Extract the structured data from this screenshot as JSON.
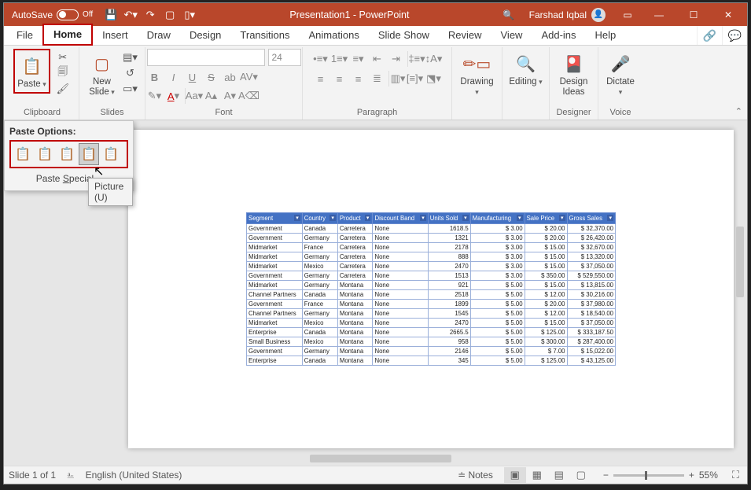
{
  "title_bar": {
    "autosave_label": "AutoSave",
    "autosave_state": "Off",
    "doc_title": "Presentation1 - PowerPoint",
    "user_name": "Farshad Iqbal"
  },
  "tabs": {
    "file": "File",
    "home": "Home",
    "insert": "Insert",
    "draw": "Draw",
    "design": "Design",
    "transitions": "Transitions",
    "animations": "Animations",
    "slideshow": "Slide Show",
    "review": "Review",
    "view": "View",
    "addins": "Add-ins",
    "help": "Help"
  },
  "ribbon": {
    "clipboard": {
      "paste": "Paste",
      "title": "Clipboard"
    },
    "slides": {
      "new_slide": "New\nSlide",
      "title": "Slides"
    },
    "font": {
      "title": "Font",
      "size_ph": "24"
    },
    "paragraph": {
      "title": "Paragraph"
    },
    "drawing": {
      "label": "Drawing"
    },
    "editing": {
      "label": "Editing"
    },
    "designer": {
      "label": "Design\nIdeas",
      "title": "Designer"
    },
    "voice": {
      "label": "Dictate",
      "title": "Voice"
    }
  },
  "paste_popup": {
    "title": "Paste Options:",
    "special_prefix": "Paste ",
    "special_u": "S",
    "special_rest": "pecial...",
    "tooltip": "Picture (U)"
  },
  "table": {
    "headers": [
      "Segment",
      "Country",
      "Product",
      "Discount Band",
      "Units Sold",
      "Manufacturing",
      "Sale Price",
      "Gross Sales"
    ],
    "rows": [
      [
        "Government",
        "Canada",
        "Carretera",
        "None",
        "1618.5",
        "$   3.00",
        "$   20.00",
        "$   32,370.00"
      ],
      [
        "Government",
        "Germany",
        "Carretera",
        "None",
        "1321",
        "$   3.00",
        "$   20.00",
        "$   26,420.00"
      ],
      [
        "Midmarket",
        "France",
        "Carretera",
        "None",
        "2178",
        "$   3.00",
        "$   15.00",
        "$   32,670.00"
      ],
      [
        "Midmarket",
        "Germany",
        "Carretera",
        "None",
        "888",
        "$   3.00",
        "$   15.00",
        "$   13,320.00"
      ],
      [
        "Midmarket",
        "Mexico",
        "Carretera",
        "None",
        "2470",
        "$   3.00",
        "$   15.00",
        "$   37,050.00"
      ],
      [
        "Government",
        "Germany",
        "Carretera",
        "None",
        "1513",
        "$   3.00",
        "$   350.00",
        "$   529,550.00"
      ],
      [
        "Midmarket",
        "Germany",
        "Montana",
        "None",
        "921",
        "$   5.00",
        "$   15.00",
        "$   13,815.00"
      ],
      [
        "Channel Partners",
        "Canada",
        "Montana",
        "None",
        "2518",
        "$   5.00",
        "$   12.00",
        "$   30,216.00"
      ],
      [
        "Government",
        "France",
        "Montana",
        "None",
        "1899",
        "$   5.00",
        "$   20.00",
        "$   37,980.00"
      ],
      [
        "Channel Partners",
        "Germany",
        "Montana",
        "None",
        "1545",
        "$   5.00",
        "$   12.00",
        "$   18,540.00"
      ],
      [
        "Midmarket",
        "Mexico",
        "Montana",
        "None",
        "2470",
        "$   5.00",
        "$   15.00",
        "$   37,050.00"
      ],
      [
        "Enterprise",
        "Canada",
        "Montana",
        "None",
        "2665.5",
        "$   5.00",
        "$   125.00",
        "$   333,187.50"
      ],
      [
        "Small Business",
        "Mexico",
        "Montana",
        "None",
        "958",
        "$   5.00",
        "$   300.00",
        "$   287,400.00"
      ],
      [
        "Government",
        "Germany",
        "Montana",
        "None",
        "2146",
        "$   5.00",
        "$   7.00",
        "$   15,022.00"
      ],
      [
        "Enterprise",
        "Canada",
        "Montana",
        "None",
        "345",
        "$   5.00",
        "$   125.00",
        "$   43,125.00"
      ]
    ]
  },
  "statusbar": {
    "slide": "Slide 1 of 1",
    "lang": "English (United States)",
    "notes": "Notes",
    "zoom": "55%"
  }
}
